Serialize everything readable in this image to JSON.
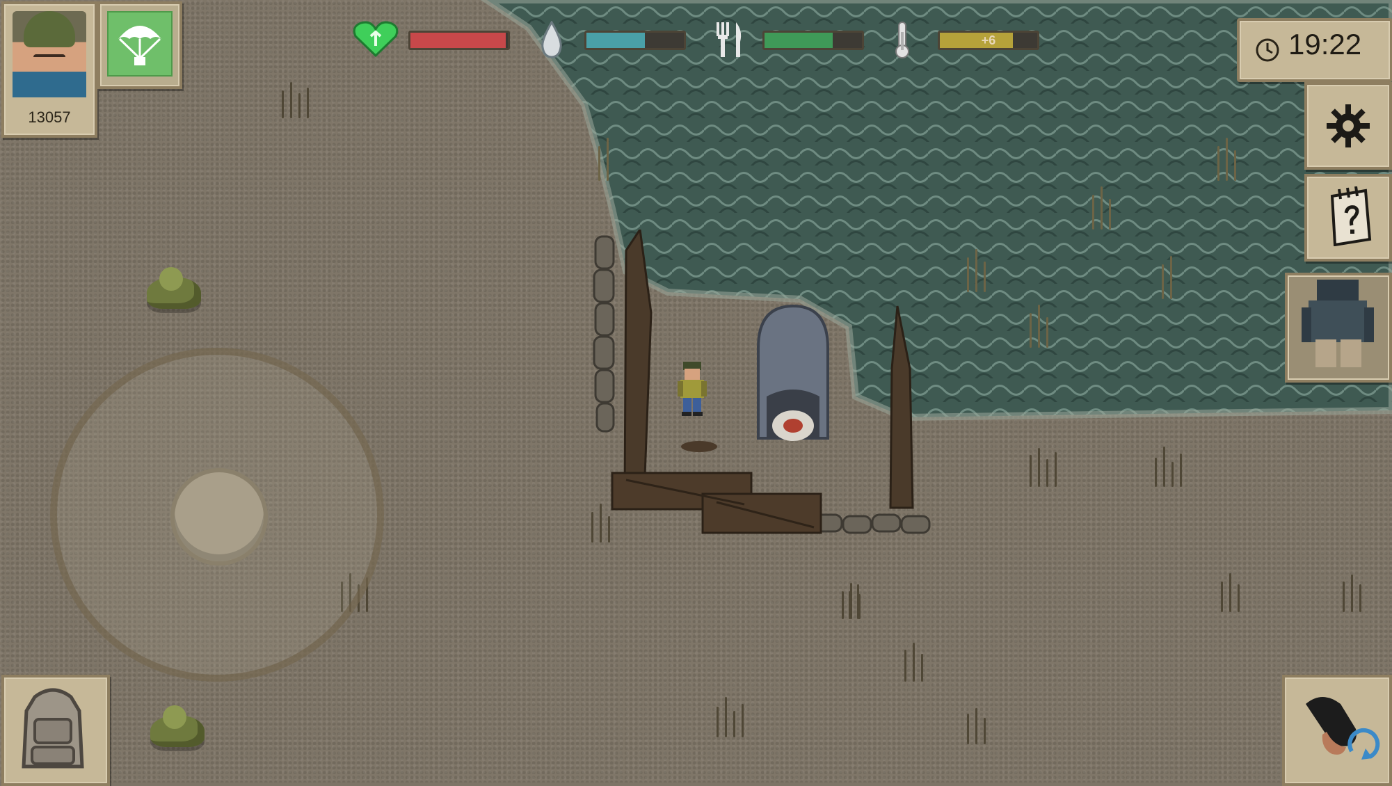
{
  "hud": {
    "score": "13057",
    "clock_time": "19:22",
    "temperature_value": "+6",
    "stats": {
      "health_level": 0.98,
      "thirst_level": 0.6,
      "hunger_level": 0.7,
      "temperature_level": 0.75
    },
    "colors": {
      "health": "#c8484a",
      "thirst": "#4aa0a8",
      "hunger": "#3f9a58",
      "temperature": "#b6a23a"
    }
  },
  "icons": {
    "avatar": "soldier-portrait-icon",
    "airdrop": "parachute-icon",
    "health": "heart-icon",
    "thirst": "water-drop-icon",
    "hunger": "fork-knife-icon",
    "temperature": "thermometer-icon",
    "clock": "clock-icon",
    "settings": "gear-icon",
    "quests": "notebook-icon",
    "character": "character-equipment-icon",
    "backpack": "backpack-icon",
    "weapon": "weapon-swap-icon"
  }
}
